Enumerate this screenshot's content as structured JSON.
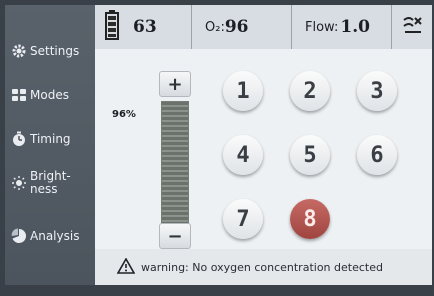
{
  "sidebar": {
    "items": [
      {
        "label": "Settings",
        "icon": "gear-icon"
      },
      {
        "label": "Modes",
        "icon": "grid-icon"
      },
      {
        "label": "Timing",
        "icon": "timer-icon"
      },
      {
        "label": "Bright-\nness",
        "icon": "sun-icon"
      },
      {
        "label": "Analysis",
        "icon": "chart-icon"
      }
    ]
  },
  "status": {
    "battery_value": "63",
    "o2_label": "O₂:",
    "o2_value": "96",
    "flow_label": "Flow:",
    "flow_value": "1.0",
    "flow_icon": "flow-off-icon"
  },
  "panel": {
    "level_text": "96%",
    "level": 0.96,
    "plus_label": "+",
    "minus_label": "−",
    "buttons": [
      "1",
      "2",
      "3",
      "4",
      "5",
      "6",
      "7",
      "8"
    ],
    "selected": "8"
  },
  "warning": {
    "icon": "warning-icon",
    "text": "warning: No oxygen concentration detected"
  },
  "colors": {
    "selected_button": "#b0524d",
    "sidebar": "#535b64"
  }
}
